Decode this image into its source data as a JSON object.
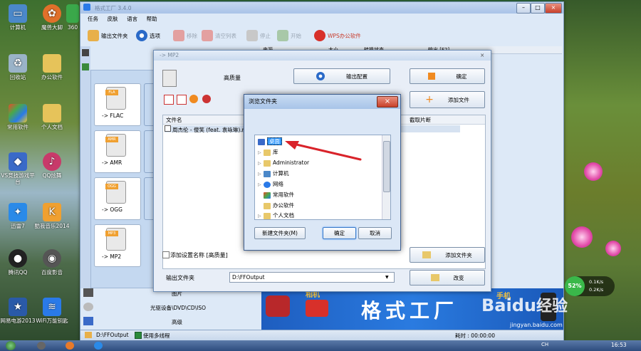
{
  "desktop": {
    "icons_left": [
      "计算机",
      "魔兽大脚",
      "回收站",
      "办公软件",
      "常用软件",
      "个人文档",
      "VS竞技游戏平台",
      "QQ炫舞",
      "迅雷7",
      "酷我音乐2014",
      "腾讯QQ",
      "百度影音",
      "网易电游2013",
      "WiFi万能钥匙"
    ],
    "partial_icon": "360"
  },
  "main_window": {
    "title": "格式工厂 3.4.0",
    "menu": [
      "任务",
      "皮肤",
      "语言",
      "帮助"
    ],
    "toolbar": {
      "output_folder": "输出文件夹",
      "options": "选项",
      "remove": "移除",
      "clear_list": "清空列表",
      "stop": "停止",
      "start": "开始",
      "wps": "WPS办公软件"
    },
    "grid_headers": [
      "来源",
      "大小",
      "转换状态",
      "输出 [F2]"
    ],
    "formats": [
      "-> FLAC",
      "-> AMR",
      "-> OGG",
      "-> MP2"
    ],
    "format_badges": [
      "FLA",
      "AMR",
      "OGG",
      "MP3"
    ],
    "bottom_list": [
      "图片",
      "光驱设备\\DVD\\CD\\ISO",
      "高级"
    ],
    "banner_text": "格式工厂",
    "banner_camera": "相机",
    "banner_phone": "手机",
    "status_path": "D:\\FFOutput",
    "status_multithread": "使用多线程",
    "status_time_label": "耗时 : 00:00:00"
  },
  "dialog": {
    "title": "-> MP2",
    "quality": "高质量",
    "output_config": "输出配置",
    "confirm": "确定",
    "add_file": "添加文件",
    "table_headers": [
      "文件名",
      "截取片断"
    ],
    "file_row": "周杰伦 - 傻笑 (feat. 袁咏琳).m",
    "add_setting_name": "添加设置名称 [高质量]",
    "add_folder": "添加文件夹",
    "output_folder_label": "输出文件夹",
    "output_folder_value": "D:\\FFOutput",
    "change": "改变"
  },
  "browse": {
    "title": "浏览文件夹",
    "tree": [
      {
        "label": "桌面",
        "selected": true,
        "icon": "desktop-icon",
        "indent": 0
      },
      {
        "label": "库",
        "icon": "library-icon",
        "indent": 1
      },
      {
        "label": "Administrator",
        "icon": "user-folder-icon",
        "indent": 1
      },
      {
        "label": "计算机",
        "icon": "computer-icon",
        "indent": 1
      },
      {
        "label": "网络",
        "icon": "network-icon",
        "indent": 1
      },
      {
        "label": "常用软件",
        "icon": "shortcut-folder-icon",
        "indent": 1
      },
      {
        "label": "办公软件",
        "icon": "folder-icon",
        "indent": 1
      },
      {
        "label": "个人文档",
        "icon": "folder-icon",
        "indent": 1
      }
    ],
    "new_folder": "新建文件夹(M)",
    "ok": "确定",
    "cancel": "取消"
  },
  "net_widget": {
    "percent": "52%",
    "up": "0.1K/s",
    "down": "0.2K/s"
  },
  "watermark": {
    "brand": "Baidu",
    "suffix": "经验",
    "url": "jingyan.baidu.com"
  },
  "taskbar": {
    "time": "16:53",
    "lang": "CH"
  },
  "colors": {
    "accent": "#1e5dbf",
    "banner_text": "#ffffff",
    "arrow": "#d9232a"
  }
}
